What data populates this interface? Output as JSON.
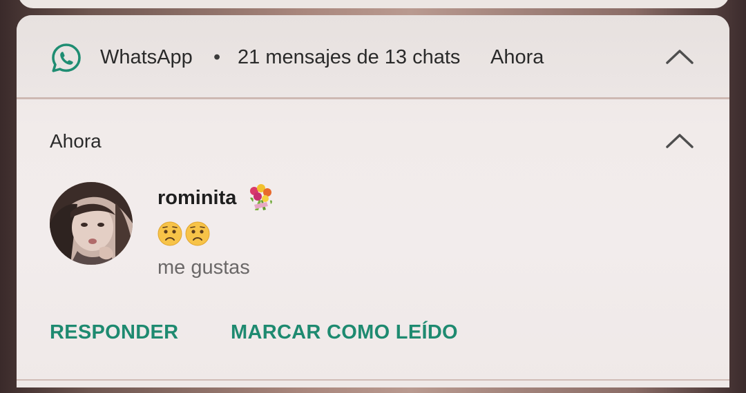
{
  "notification": {
    "app_name": "WhatsApp",
    "separator": "•",
    "summary": "21 mensajes de 13 chats",
    "time": "Ahora",
    "group_time": "Ahora",
    "sender": "rominita",
    "sender_emoji": "bouquet-emoji",
    "emoji_line": [
      "worried-face-emoji",
      "worried-face-emoji"
    ],
    "message": "me gustas",
    "actions": {
      "reply": "RESPONDER",
      "mark_read": "MARCAR COMO LEÍDO"
    }
  },
  "colors": {
    "whatsapp_green": "#1e8a70",
    "text_primary": "#1e1e1e",
    "text_secondary": "#6b6868"
  },
  "icons": {
    "app": "whatsapp-icon",
    "expand_header": "chevron-up-icon",
    "expand_group": "chevron-up-icon"
  }
}
